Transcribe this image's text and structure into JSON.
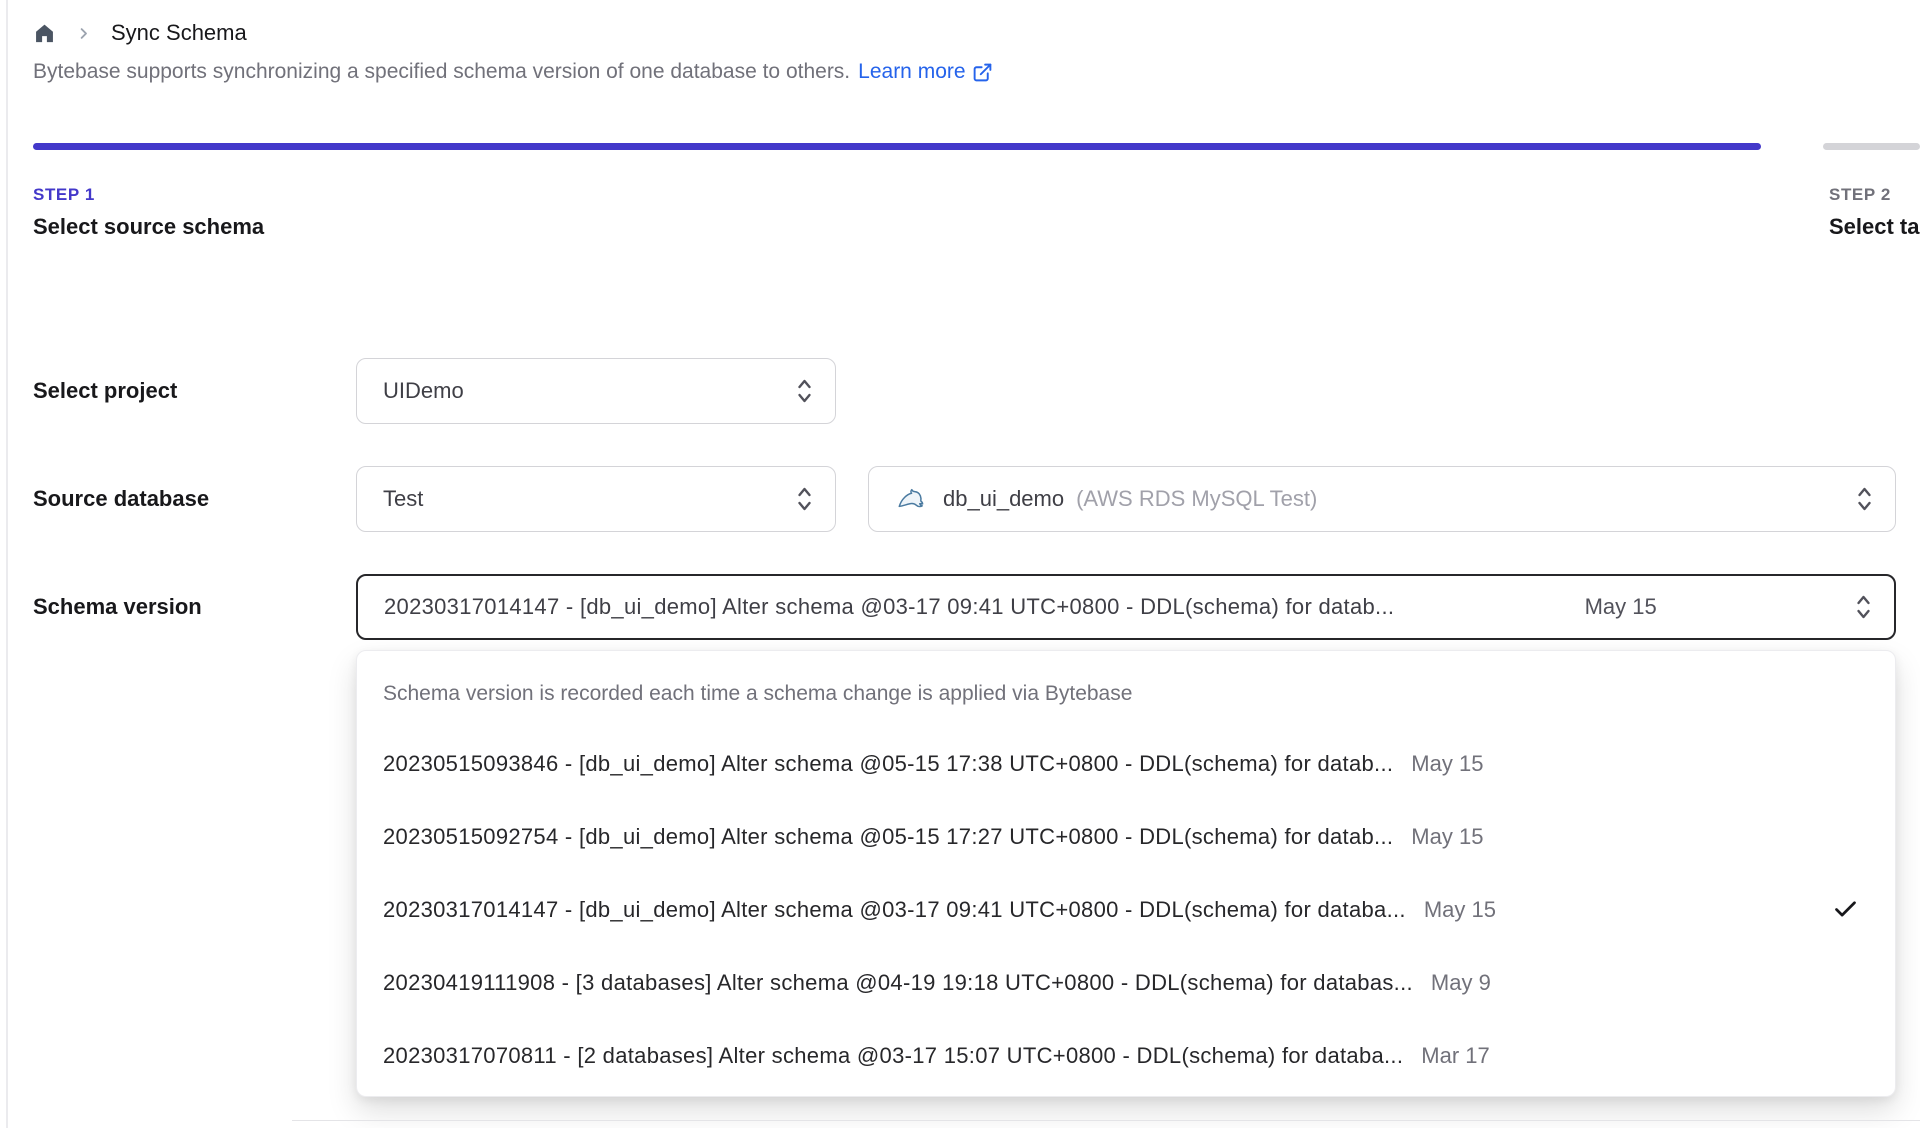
{
  "colors": {
    "accent_indigo": "#4338ca",
    "link_blue": "#2563eb",
    "idle_gray": "#d4d4d8"
  },
  "breadcrumb": {
    "title": "Sync Schema"
  },
  "intro": {
    "text": "Bytebase supports synchronizing a specified schema version of one database to others.",
    "link_label": "Learn more"
  },
  "steps": [
    {
      "step_no": "STEP 1",
      "title": "Select source schema",
      "active": true
    },
    {
      "step_no": "STEP 2",
      "title": "Select target databases",
      "active": false
    }
  ],
  "form": {
    "project": {
      "label": "Select project",
      "value": "UIDemo"
    },
    "source_database": {
      "label": "Source database",
      "environment_value": "Test",
      "database_value": "db_ui_demo",
      "database_detail": "(AWS RDS MySQL Test)"
    },
    "schema_version": {
      "label": "Schema version",
      "value": "20230317014147 - [db_ui_demo] Alter schema @03-17 09:41 UTC+0800 - DDL(schema) for datab...",
      "value_date": "May 15"
    }
  },
  "dropdown": {
    "hint": "Schema version is recorded each time a schema change is applied via Bytebase",
    "options": [
      {
        "text": "20230515093846 - [db_ui_demo] Alter schema @05-15 17:38 UTC+0800 - DDL(schema) for datab...",
        "date": "May 15",
        "selected": false
      },
      {
        "text": "20230515092754 - [db_ui_demo] Alter schema @05-15 17:27 UTC+0800 - DDL(schema) for datab...",
        "date": "May 15",
        "selected": false
      },
      {
        "text": "20230317014147 - [db_ui_demo] Alter schema @03-17 09:41 UTC+0800 - DDL(schema) for databa...",
        "date": "May 15",
        "selected": true
      },
      {
        "text": "20230419111908 - [3 databases] Alter schema @04-19 19:18 UTC+0800 - DDL(schema) for databas...",
        "date": "May 9",
        "selected": false
      },
      {
        "text": "20230317070811 - [2 databases] Alter schema @03-17 15:07 UTC+0800 - DDL(schema) for databa...",
        "date": "Mar 17",
        "selected": false
      }
    ]
  }
}
